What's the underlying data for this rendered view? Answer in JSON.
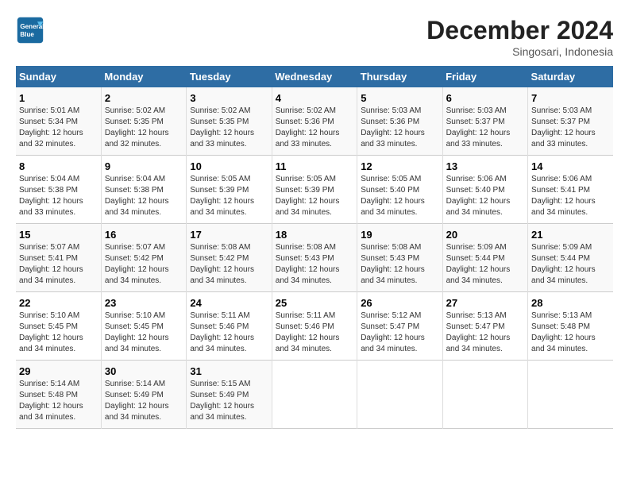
{
  "logo": {
    "line1": "General",
    "line2": "Blue"
  },
  "title": "December 2024",
  "location": "Singosari, Indonesia",
  "headers": [
    "Sunday",
    "Monday",
    "Tuesday",
    "Wednesday",
    "Thursday",
    "Friday",
    "Saturday"
  ],
  "weeks": [
    [
      {
        "day": "1",
        "sunrise": "Sunrise: 5:01 AM",
        "sunset": "Sunset: 5:34 PM",
        "daylight": "Daylight: 12 hours and 32 minutes."
      },
      {
        "day": "2",
        "sunrise": "Sunrise: 5:02 AM",
        "sunset": "Sunset: 5:35 PM",
        "daylight": "Daylight: 12 hours and 32 minutes."
      },
      {
        "day": "3",
        "sunrise": "Sunrise: 5:02 AM",
        "sunset": "Sunset: 5:35 PM",
        "daylight": "Daylight: 12 hours and 33 minutes."
      },
      {
        "day": "4",
        "sunrise": "Sunrise: 5:02 AM",
        "sunset": "Sunset: 5:36 PM",
        "daylight": "Daylight: 12 hours and 33 minutes."
      },
      {
        "day": "5",
        "sunrise": "Sunrise: 5:03 AM",
        "sunset": "Sunset: 5:36 PM",
        "daylight": "Daylight: 12 hours and 33 minutes."
      },
      {
        "day": "6",
        "sunrise": "Sunrise: 5:03 AM",
        "sunset": "Sunset: 5:37 PM",
        "daylight": "Daylight: 12 hours and 33 minutes."
      },
      {
        "day": "7",
        "sunrise": "Sunrise: 5:03 AM",
        "sunset": "Sunset: 5:37 PM",
        "daylight": "Daylight: 12 hours and 33 minutes."
      }
    ],
    [
      {
        "day": "8",
        "sunrise": "Sunrise: 5:04 AM",
        "sunset": "Sunset: 5:38 PM",
        "daylight": "Daylight: 12 hours and 33 minutes."
      },
      {
        "day": "9",
        "sunrise": "Sunrise: 5:04 AM",
        "sunset": "Sunset: 5:38 PM",
        "daylight": "Daylight: 12 hours and 34 minutes."
      },
      {
        "day": "10",
        "sunrise": "Sunrise: 5:05 AM",
        "sunset": "Sunset: 5:39 PM",
        "daylight": "Daylight: 12 hours and 34 minutes."
      },
      {
        "day": "11",
        "sunrise": "Sunrise: 5:05 AM",
        "sunset": "Sunset: 5:39 PM",
        "daylight": "Daylight: 12 hours and 34 minutes."
      },
      {
        "day": "12",
        "sunrise": "Sunrise: 5:05 AM",
        "sunset": "Sunset: 5:40 PM",
        "daylight": "Daylight: 12 hours and 34 minutes."
      },
      {
        "day": "13",
        "sunrise": "Sunrise: 5:06 AM",
        "sunset": "Sunset: 5:40 PM",
        "daylight": "Daylight: 12 hours and 34 minutes."
      },
      {
        "day": "14",
        "sunrise": "Sunrise: 5:06 AM",
        "sunset": "Sunset: 5:41 PM",
        "daylight": "Daylight: 12 hours and 34 minutes."
      }
    ],
    [
      {
        "day": "15",
        "sunrise": "Sunrise: 5:07 AM",
        "sunset": "Sunset: 5:41 PM",
        "daylight": "Daylight: 12 hours and 34 minutes."
      },
      {
        "day": "16",
        "sunrise": "Sunrise: 5:07 AM",
        "sunset": "Sunset: 5:42 PM",
        "daylight": "Daylight: 12 hours and 34 minutes."
      },
      {
        "day": "17",
        "sunrise": "Sunrise: 5:08 AM",
        "sunset": "Sunset: 5:42 PM",
        "daylight": "Daylight: 12 hours and 34 minutes."
      },
      {
        "day": "18",
        "sunrise": "Sunrise: 5:08 AM",
        "sunset": "Sunset: 5:43 PM",
        "daylight": "Daylight: 12 hours and 34 minutes."
      },
      {
        "day": "19",
        "sunrise": "Sunrise: 5:08 AM",
        "sunset": "Sunset: 5:43 PM",
        "daylight": "Daylight: 12 hours and 34 minutes."
      },
      {
        "day": "20",
        "sunrise": "Sunrise: 5:09 AM",
        "sunset": "Sunset: 5:44 PM",
        "daylight": "Daylight: 12 hours and 34 minutes."
      },
      {
        "day": "21",
        "sunrise": "Sunrise: 5:09 AM",
        "sunset": "Sunset: 5:44 PM",
        "daylight": "Daylight: 12 hours and 34 minutes."
      }
    ],
    [
      {
        "day": "22",
        "sunrise": "Sunrise: 5:10 AM",
        "sunset": "Sunset: 5:45 PM",
        "daylight": "Daylight: 12 hours and 34 minutes."
      },
      {
        "day": "23",
        "sunrise": "Sunrise: 5:10 AM",
        "sunset": "Sunset: 5:45 PM",
        "daylight": "Daylight: 12 hours and 34 minutes."
      },
      {
        "day": "24",
        "sunrise": "Sunrise: 5:11 AM",
        "sunset": "Sunset: 5:46 PM",
        "daylight": "Daylight: 12 hours and 34 minutes."
      },
      {
        "day": "25",
        "sunrise": "Sunrise: 5:11 AM",
        "sunset": "Sunset: 5:46 PM",
        "daylight": "Daylight: 12 hours and 34 minutes."
      },
      {
        "day": "26",
        "sunrise": "Sunrise: 5:12 AM",
        "sunset": "Sunset: 5:47 PM",
        "daylight": "Daylight: 12 hours and 34 minutes."
      },
      {
        "day": "27",
        "sunrise": "Sunrise: 5:13 AM",
        "sunset": "Sunset: 5:47 PM",
        "daylight": "Daylight: 12 hours and 34 minutes."
      },
      {
        "day": "28",
        "sunrise": "Sunrise: 5:13 AM",
        "sunset": "Sunset: 5:48 PM",
        "daylight": "Daylight: 12 hours and 34 minutes."
      }
    ],
    [
      {
        "day": "29",
        "sunrise": "Sunrise: 5:14 AM",
        "sunset": "Sunset: 5:48 PM",
        "daylight": "Daylight: 12 hours and 34 minutes."
      },
      {
        "day": "30",
        "sunrise": "Sunrise: 5:14 AM",
        "sunset": "Sunset: 5:49 PM",
        "daylight": "Daylight: 12 hours and 34 minutes."
      },
      {
        "day": "31",
        "sunrise": "Sunrise: 5:15 AM",
        "sunset": "Sunset: 5:49 PM",
        "daylight": "Daylight: 12 hours and 34 minutes."
      },
      null,
      null,
      null,
      null
    ]
  ]
}
